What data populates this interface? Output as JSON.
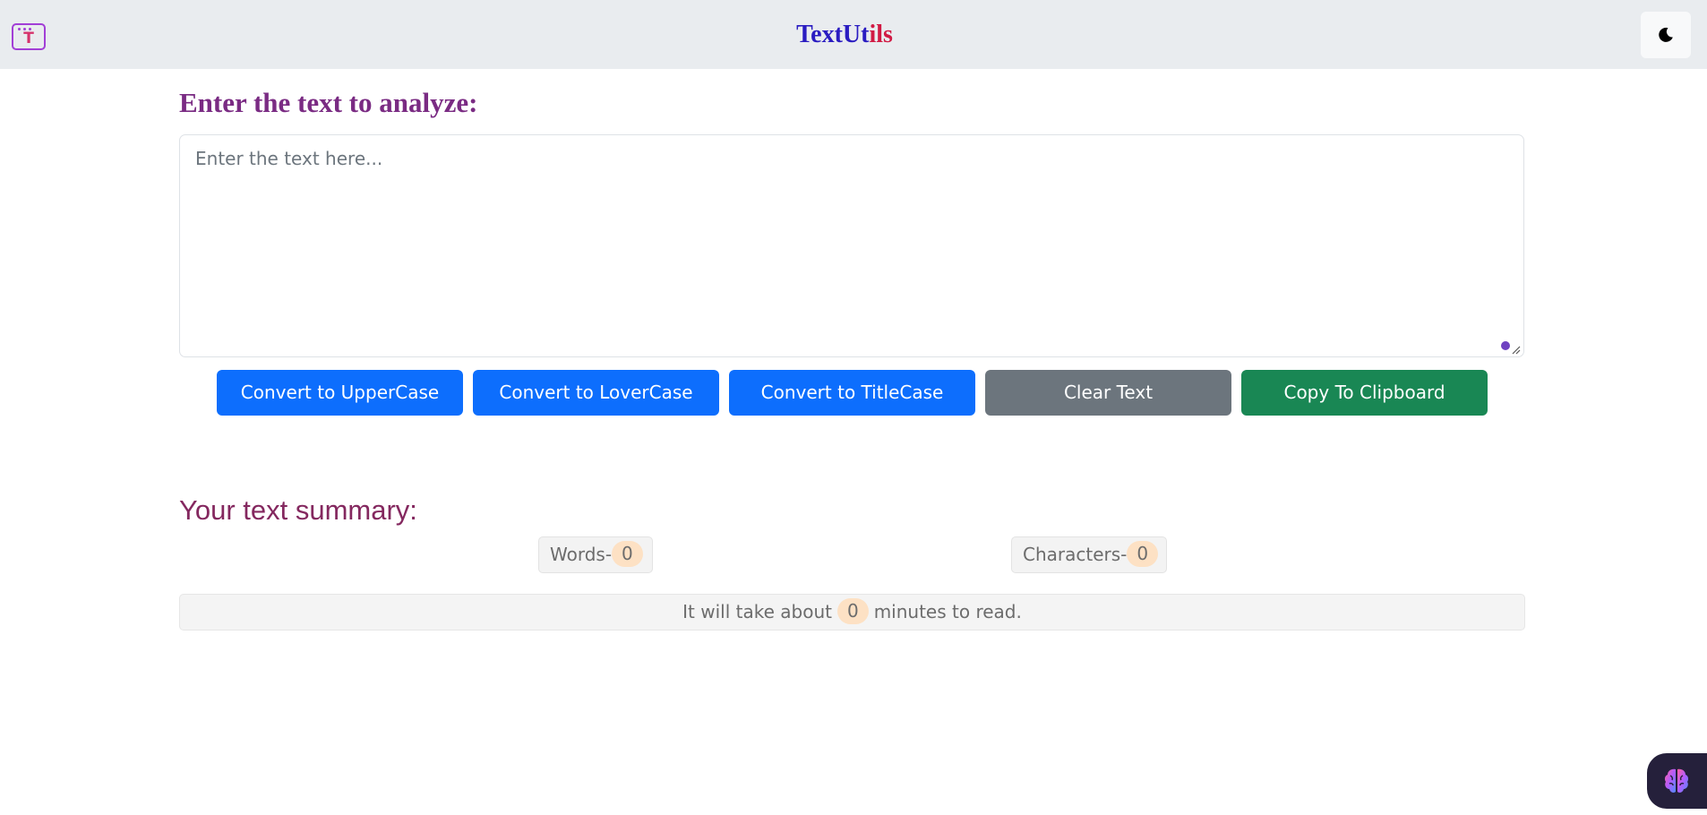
{
  "navbar": {
    "brand_part1": "TextUt",
    "brand_part2": "ils",
    "logo_letter": "T"
  },
  "editor": {
    "heading": "Enter the text to analyze:",
    "placeholder": "Enter the text here..."
  },
  "buttons": {
    "uppercase": "Convert to UpperCase",
    "lowercase": "Convert to LoverCase",
    "titlecase": "Convert to TitleCase",
    "clear": "Clear Text",
    "copy": "Copy To Clipboard"
  },
  "summary": {
    "heading": "Your text summary:",
    "words_label": "Words-",
    "words_count": "0",
    "chars_label": "Characters-",
    "chars_count": "0",
    "read_prefix": "It will take about",
    "read_minutes": "0",
    "read_suffix": "minutes to read."
  },
  "colors": {
    "brand_blue": "#2a1cc1",
    "brand_red": "#d11a44",
    "heading": "#7a2b83",
    "primary": "#0d6efd",
    "secondary": "#6c757d",
    "success": "#198754",
    "badge": "#fde1c4"
  },
  "icons": {
    "logo": "textutils-logo-icon",
    "theme_toggle": "moon-icon",
    "assistant": "brain-icon"
  }
}
